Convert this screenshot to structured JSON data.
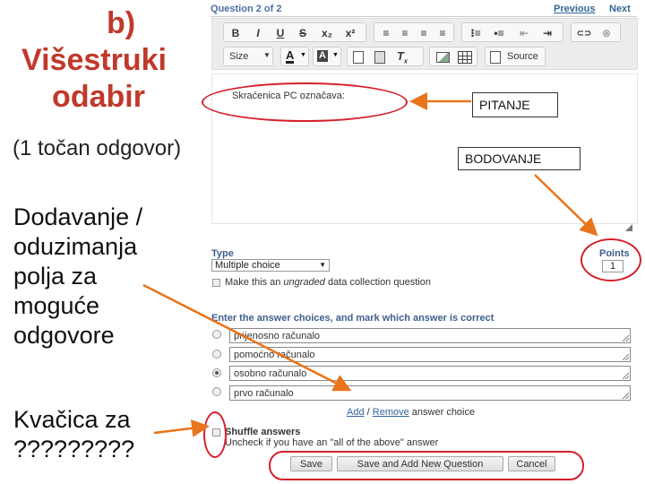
{
  "slide": {
    "title_line1": "b)",
    "title_line2": "Višestruki",
    "title_line3": "odabir",
    "subtitle": "(1 točan odgovor)",
    "note_add_remove": [
      "Dodavanje /",
      "oduzimanja",
      "polja za",
      "moguće",
      "odgovore"
    ],
    "note_checkbox": [
      "Kvačica za",
      "?????????"
    ]
  },
  "callouts": {
    "question_label": "PITANJE",
    "points_label": "BODOVANJE"
  },
  "editor": {
    "question_counter": "Question 2 of 2",
    "previous": "Previous",
    "next": "Next",
    "toolbar": {
      "row1": [
        "B",
        "I",
        "U",
        "S",
        "x₂",
        "x²",
        "≡",
        "≡",
        "≡",
        "≡",
        "⁝≡",
        "•≡",
        "⇤",
        "⇥",
        "⊂⊃",
        "⊗"
      ],
      "size_label": "Size",
      "font_color": "A",
      "bg_color": "A",
      "source_label": "Source"
    },
    "question_text": "Skraćenica PC označava:",
    "type_label": "Type",
    "type_value": "Multiple choice",
    "ungraded_pre": "Make this an ",
    "ungraded_em": "ungraded",
    "ungraded_post": " data collection question",
    "points_heading": "Points",
    "points_value": "1",
    "answers_heading": "Enter the answer choices, and mark which answer is correct",
    "answers": [
      {
        "text": "prijenosno računalo",
        "selected": false
      },
      {
        "text": "pomoćno računalo",
        "selected": false
      },
      {
        "text": "osobno računalo",
        "selected": true
      },
      {
        "text": "prvo računalo",
        "selected": false
      }
    ],
    "add_link": "Add",
    "remove_sep": "/",
    "remove_link": "Remove",
    "answer_choice": "answer choice",
    "shuffle_label": "Shuffle answers",
    "shuffle_hint": "Uncheck if you have an \"all of the above\" answer",
    "buttons": {
      "save": "Save",
      "save_add": "Save and Add New Question",
      "cancel": "Cancel"
    }
  },
  "colors": {
    "title": "#c0392b",
    "annotation_red": "#d6202a",
    "arrow_orange": "#e8741c",
    "link_blue": "#336699"
  }
}
